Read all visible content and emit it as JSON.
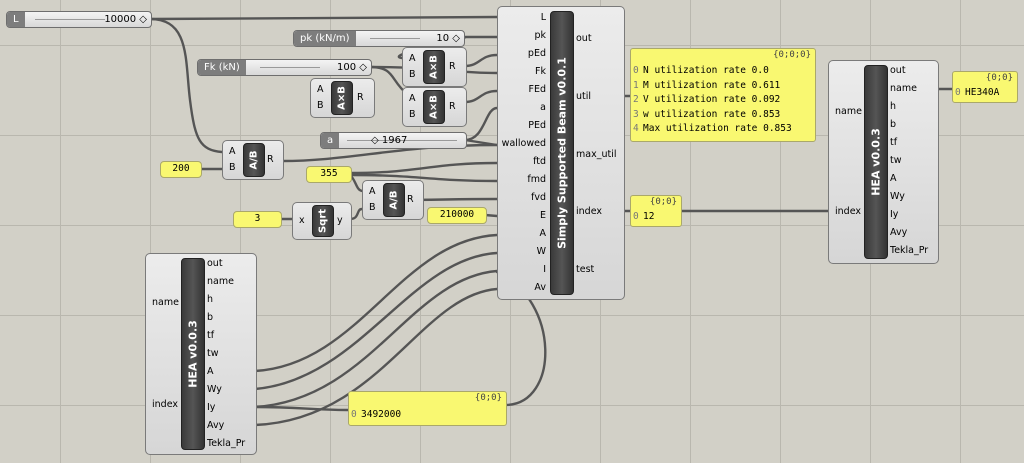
{
  "sliders": {
    "L": {
      "label": "L",
      "value": "10000 ◇"
    },
    "pk": {
      "label": "pk (kN/m)",
      "value": "10 ◇"
    },
    "Fk": {
      "label": "Fk (kN)",
      "value": "100 ◇"
    },
    "a": {
      "label": "a",
      "value": "◇ 1967"
    }
  },
  "inputs": {
    "v200": "200",
    "v355": "355",
    "v3": "3",
    "v210000": "210000"
  },
  "ops": {
    "ab": {
      "a": "A",
      "b": "B",
      "r": "R",
      "core": "A×B"
    },
    "div": {
      "a": "A",
      "b": "B",
      "r": "R",
      "core": "A/B"
    },
    "sqrt": {
      "x": "x",
      "y": "y",
      "core": "Sqrt"
    }
  },
  "beam": {
    "title": "Simply Supported Beam v0.0.1",
    "inputs": [
      "L",
      "pk",
      "pEd",
      "Fk",
      "FEd",
      "a",
      "PEd",
      "wallowed",
      "ftd",
      "fmd",
      "fvd",
      "E",
      "A",
      "W",
      "I",
      "Av"
    ],
    "outputs": [
      "out",
      "util",
      "max_util",
      "index",
      "test"
    ]
  },
  "hea_left": {
    "title": "HEA v0.0.3",
    "inputs": [
      "name",
      "index"
    ],
    "outputs": [
      "out",
      "name",
      "h",
      "b",
      "tf",
      "tw",
      "A",
      "Wy",
      "Iy",
      "Avy",
      "Tekla_Pr"
    ]
  },
  "hea_right": {
    "title": "HEA v0.0.3",
    "inputs": [
      "name",
      "index"
    ],
    "outputs": [
      "out",
      "name",
      "h",
      "b",
      "tf",
      "tw",
      "A",
      "Wy",
      "Iy",
      "Avy",
      "Tekla_Pr"
    ]
  },
  "util_panel": {
    "path": "{0;0;0}",
    "rows": [
      {
        "i": "0",
        "text": "N utilization rate 0.0"
      },
      {
        "i": "1",
        "text": "M utilization rate 0.611"
      },
      {
        "i": "2",
        "text": "V utilization rate 0.092"
      },
      {
        "i": "3",
        "text": "w utilization rate 0.853"
      },
      {
        "i": "4",
        "text": "Max utilization rate 0.853"
      }
    ]
  },
  "index_panel": {
    "path": "{0;0}",
    "rows": [
      {
        "i": "0",
        "text": "12"
      }
    ]
  },
  "name_panel": {
    "path": "{0;0}",
    "rows": [
      {
        "i": "0",
        "text": "HE340A"
      }
    ]
  },
  "iy_panel": {
    "path": "{0;0}",
    "rows": [
      {
        "i": "0",
        "text": "3492000"
      }
    ]
  }
}
